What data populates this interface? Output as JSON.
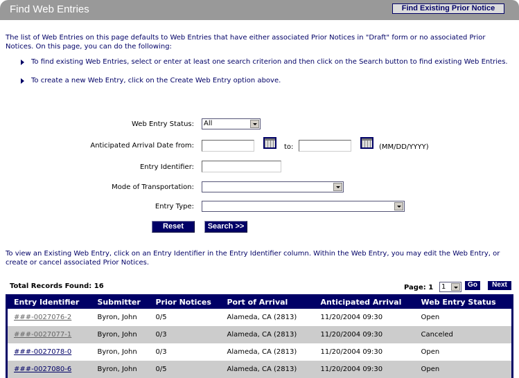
{
  "header": {
    "title": "Find Web Entries",
    "find_prior_notice_button": "Find Existing Prior Notice"
  },
  "intro": {
    "text": "The list of Web Entries on this page defaults to Web Entries that have either associated Prior Notices in \"Draft\" form or no associated Prior Notices. On this page, you can do the following:",
    "bullets": [
      "To find existing Web Entries, select or enter at least one search criterion and then click on the Search button to find existing Web Entries.",
      "To create a new Web Entry, click on the Create Web Entry option above."
    ]
  },
  "form": {
    "status_label": "Web Entry Status:",
    "status_value": "All",
    "date_from_label": "Anticipated Arrival Date from:",
    "date_from_value": "",
    "date_to_label": "to:",
    "date_to_value": "",
    "date_format_hint": "(MM/DD/YYYY)",
    "entry_identifier_label": "Entry Identifier:",
    "entry_identifier_value": "",
    "mode_label": "Mode of Transportation:",
    "mode_value": "",
    "entry_type_label": "Entry Type:",
    "entry_type_value": "",
    "reset_button": "Reset",
    "search_button": "Search >>"
  },
  "results": {
    "note": "To view an Existing Web Entry, click on an Entry Identifier in the Entry Identifier column. Within the Web Entry, you may edit the Web Entry, or create or cancel associated Prior Notices.",
    "total_label": "Total Records Found: 16",
    "page_label": "Page: 1",
    "page_select_value": "1",
    "go_button": "Go",
    "next_button": "Next",
    "columns": [
      "Entry Identifier",
      "Submitter",
      "Prior Notices",
      "Port of Arrival",
      "Anticipated Arrival",
      "Web Entry Status"
    ],
    "rows": [
      {
        "id": "###-0027076-2",
        "visited": true,
        "submitter": "Byron, John",
        "prior_notices": "0/5",
        "port": "Alameda, CA (2813)",
        "arrival": "11/20/2004 09:30",
        "status": "Open"
      },
      {
        "id": "###-0027077-1",
        "visited": true,
        "submitter": "Byron, John",
        "prior_notices": "0/3",
        "port": "Alameda, CA (2813)",
        "arrival": "11/20/2004 09:30",
        "status": "Canceled"
      },
      {
        "id": "###-0027078-0",
        "visited": false,
        "submitter": "Byron, John",
        "prior_notices": "0/3",
        "port": "Alameda, CA (2813)",
        "arrival": "11/20/2004 09:30",
        "status": "Open"
      },
      {
        "id": "###-0027080-6",
        "visited": false,
        "submitter": "Byron, John",
        "prior_notices": "0/5",
        "port": "Alameda, CA (2813)",
        "arrival": "11/20/2004 09:30",
        "status": "Open"
      }
    ]
  }
}
